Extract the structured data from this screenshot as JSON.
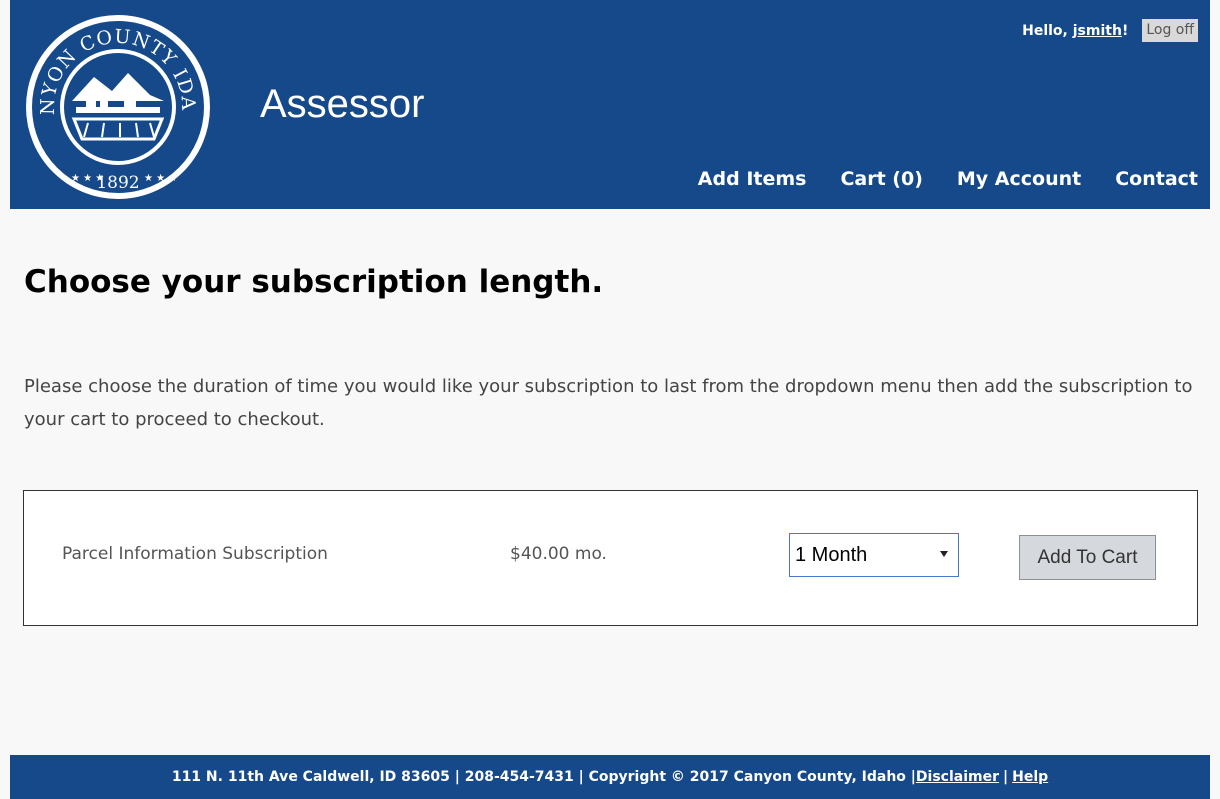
{
  "colors": {
    "brand_blue": "#15498a",
    "background": "#f8f8f8",
    "text_gray": "#555555"
  },
  "header": {
    "seal": {
      "top_text": "CANYON COUNTY IDAHO",
      "year": "1892"
    },
    "title": "Assessor",
    "user": {
      "greeting": "Hello, ",
      "username": "jsmith",
      "exclaim": "!",
      "logoff_label": "Log off"
    },
    "nav": [
      {
        "label": "Add Items"
      },
      {
        "label": "Cart (0)"
      },
      {
        "label": "My Account"
      },
      {
        "label": "Contact"
      }
    ]
  },
  "main": {
    "heading": "Choose your subscription length.",
    "intro": "Please choose the duration of time you would like your subscription to last from the dropdown menu then add the subscription to your cart to proceed to checkout.",
    "product": {
      "name": "Parcel Information Subscription",
      "price": "$40.00 mo.",
      "duration_selected": "1 Month",
      "add_label": "Add To Cart"
    }
  },
  "footer": {
    "info": "111 N. 11th Ave Caldwell, ID 83605 | 208-454-7431 | Copyright © 2017 Canyon County, Idaho | ",
    "disclaimer": "Disclaimer",
    "separator": "|",
    "help": "Help"
  }
}
